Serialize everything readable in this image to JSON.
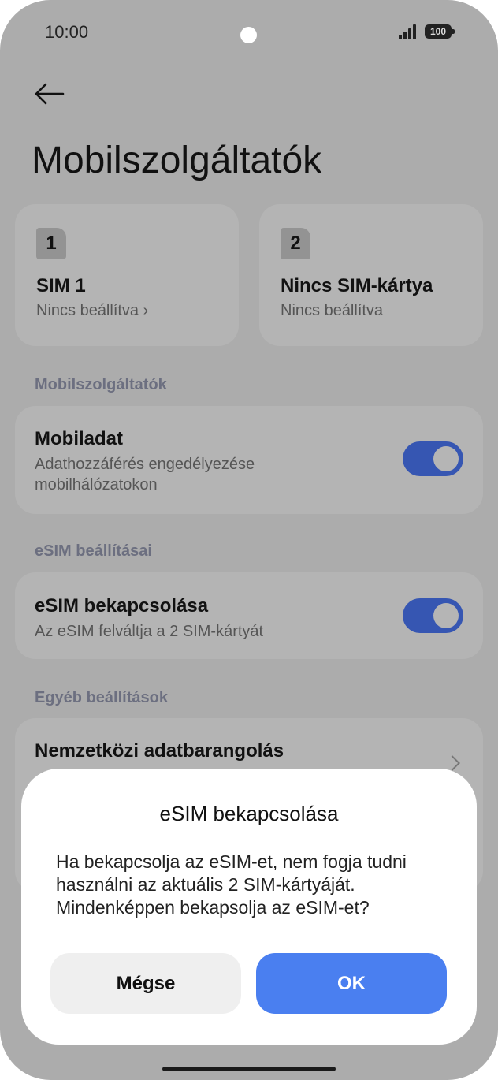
{
  "status_bar": {
    "time": "10:00",
    "battery": "100"
  },
  "header": {
    "title": "Mobilszolgáltatók"
  },
  "sim_cards": [
    {
      "slot": "1",
      "name": "SIM 1",
      "status": "Nincs beállítva ›"
    },
    {
      "slot": "2",
      "name": "Nincs SIM-kártya",
      "status": "Nincs beállítva"
    }
  ],
  "sections": {
    "carriers": {
      "label": "Mobilszolgáltatók",
      "mobile_data": {
        "title": "Mobiladat",
        "subtitle": "Adathozzáférés engedélyezése mobilhálózatokon",
        "enabled": true
      }
    },
    "esim": {
      "label": "eSIM beállításai",
      "esim_enable": {
        "title": "eSIM bekapcsolása",
        "subtitle": "Az eSIM felváltja a 2 SIM-kártyát",
        "enabled": true
      }
    },
    "other": {
      "label": "Egyéb beállítások",
      "roaming": {
        "title": "Nemzetközi adatbarangolás"
      }
    }
  },
  "dialog": {
    "title": "eSIM bekapcsolása",
    "message": "Ha bekapcsolja az eSIM-et, nem fogja tudni használni az aktuális 2 SIM-kártyáját. Mindenképpen bekapsolja az eSIM-et?",
    "cancel_label": "Mégse",
    "ok_label": "OK"
  },
  "colors": {
    "scrim_background": "#acacac",
    "toggle_on": "#3656b2",
    "ok_button": "#4a7ff0",
    "cancel_button": "#efefef"
  }
}
